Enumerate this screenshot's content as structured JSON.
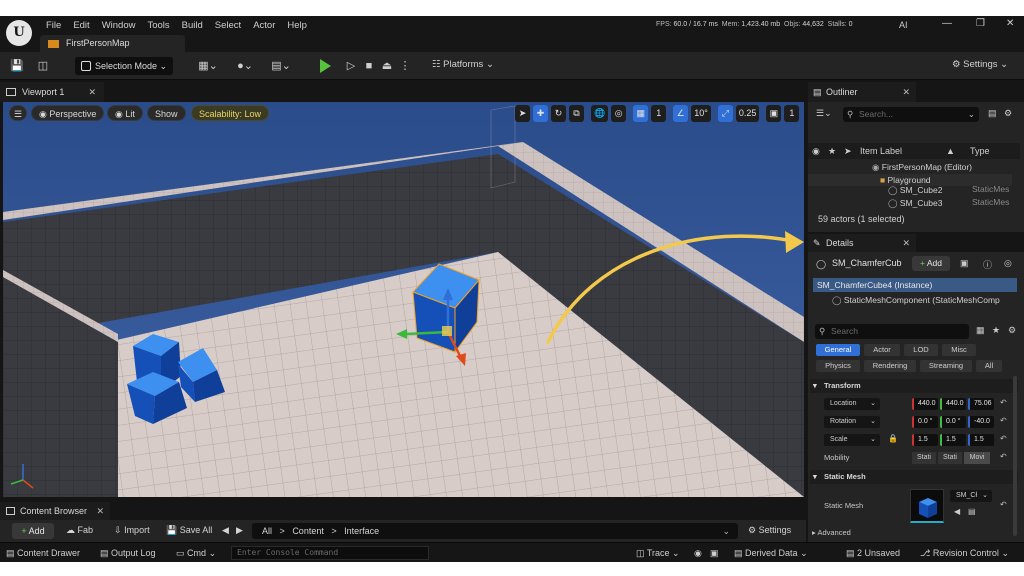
{
  "menubar": {
    "items": [
      "File",
      "Edit",
      "Window",
      "Tools",
      "Build",
      "Select",
      "Actor",
      "Help"
    ],
    "map_tab": "FirstPersonMap",
    "stats": {
      "fps_label": "FPS:",
      "fps": "60.0",
      "ms": "/ 16.7 ms",
      "mem_label": "Mem:",
      "mem": "1,423.40 mb",
      "objs_label": "Objs:",
      "objs": "44,632",
      "stalls_label": "Stalls:",
      "stalls": "0"
    },
    "ai": "AI"
  },
  "toolbar": {
    "selection_mode": "Selection Mode",
    "platforms": "Platforms",
    "settings": "Settings"
  },
  "viewport": {
    "tab": "Viewport 1",
    "perspective": "Perspective",
    "lit": "Lit",
    "show": "Show",
    "scalability": "Scalability: Low",
    "grid_value": "1",
    "angle_value": "10°",
    "scale_value": "0.25",
    "camera_value": "1"
  },
  "content_browser": {
    "tab": "Content Browser",
    "add": "Add",
    "fab": "Fab",
    "import": "Import",
    "save_all": "Save All",
    "path": [
      "All",
      ">",
      "Content",
      ">",
      "Interface"
    ],
    "settings": "Settings"
  },
  "statusbar": {
    "content_drawer": "Content Drawer",
    "output_log": "Output Log",
    "cmd": "Cmd",
    "console_placeholder": "Enter Console Command",
    "trace": "Trace",
    "derived_data": "Derived Data",
    "unsaved": "2 Unsaved",
    "revision_control": "Revision Control"
  },
  "outliner": {
    "tab": "Outliner",
    "search_placeholder": "Search...",
    "col_label": "Item Label",
    "col_type": "Type",
    "rows": [
      {
        "label": "FirstPersonMap (Editor)",
        "type": ""
      },
      {
        "label": "Playground",
        "type": ""
      },
      {
        "label": "SM_Cube2",
        "type": "StaticMes"
      },
      {
        "label": "SM_Cube3",
        "type": "StaticMes"
      }
    ],
    "actors_count": "59 actors (1 selected)"
  },
  "details": {
    "tab": "Details",
    "actor_name": "SM_ChamferCub",
    "add": "Add",
    "instance": "SM_ChamferCube4 (Instance)",
    "component": "StaticMeshComponent (StaticMeshComp",
    "search_placeholder": "Search",
    "filters_row1": [
      "General",
      "Actor",
      "LOD",
      "Misc"
    ],
    "filters_row2": [
      "Physics",
      "Rendering",
      "Streaming",
      "All"
    ],
    "transform_section": "Transform",
    "location": {
      "label": "Location",
      "x": "440.0",
      "y": "440.0",
      "z": "75.06"
    },
    "rotation": {
      "label": "Rotation",
      "x": "0.0 °",
      "y": "0.0 °",
      "z": "-40.0"
    },
    "scale": {
      "label": "Scale",
      "x": "1.5",
      "y": "1.5",
      "z": "1.5"
    },
    "mobility_label": "Mobility",
    "mobility_options": [
      "Stati",
      "Stati",
      "Movi"
    ],
    "static_mesh_section": "Static Mesh",
    "static_mesh_label": "Static Mesh",
    "static_mesh_value": "SM_Cł",
    "advanced": "Advanced"
  },
  "colors": {
    "accent_blue": "#2f6fd6",
    "play_green": "#56c23e",
    "annotation_yellow": "#f2c94c",
    "selection_orange": "#f0a020"
  }
}
